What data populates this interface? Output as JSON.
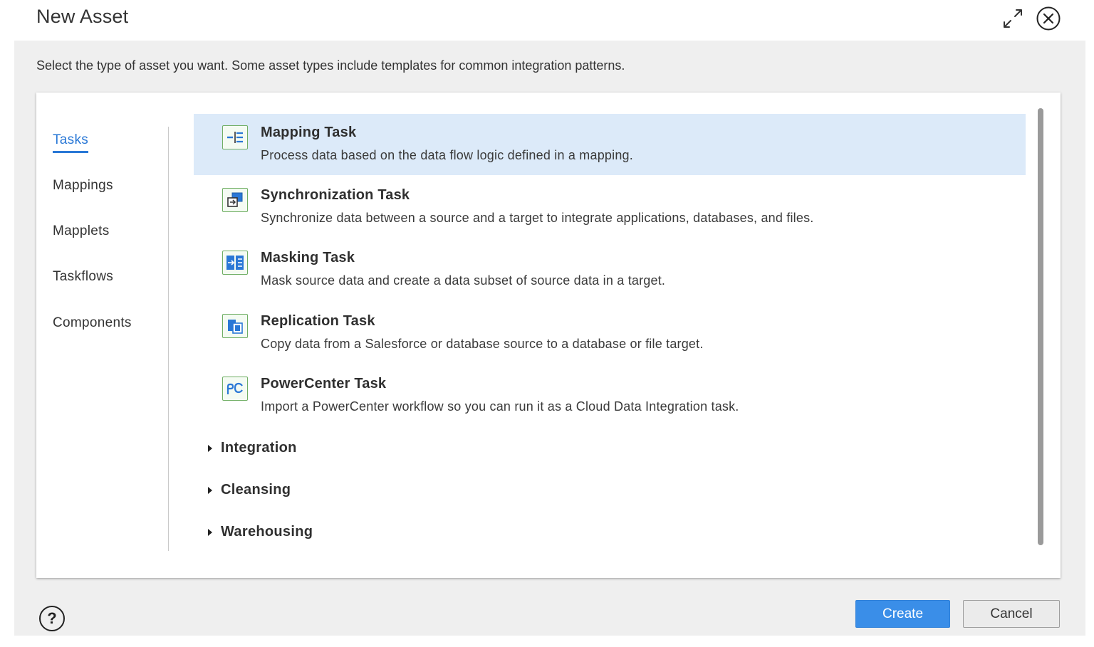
{
  "dialog": {
    "title": "New Asset",
    "instructions": "Select the type of asset you want. Some asset types include templates for common integration patterns."
  },
  "icons": {
    "maximize": "expand-arrows-icon",
    "close": "close-circle-icon",
    "help": "question-circle-icon"
  },
  "categories": [
    {
      "label": "Tasks",
      "active": true
    },
    {
      "label": "Mappings",
      "active": false
    },
    {
      "label": "Mapplets",
      "active": false
    },
    {
      "label": "Taskflows",
      "active": false
    },
    {
      "label": "Components",
      "active": false
    }
  ],
  "assets": [
    {
      "name": "Mapping Task",
      "description": "Process data based on the data flow logic defined in a mapping.",
      "icon": "mapping-task-icon",
      "selected": true
    },
    {
      "name": "Synchronization Task",
      "description": "Synchronize data between a source and a target to integrate applications, databases, and files.",
      "icon": "synchronization-task-icon",
      "selected": false
    },
    {
      "name": "Masking Task",
      "description": "Mask source data and create a data subset of source data in a target.",
      "icon": "masking-task-icon",
      "selected": false
    },
    {
      "name": "Replication Task",
      "description": "Copy data from a Salesforce or database source to a database or file target.",
      "icon": "replication-task-icon",
      "selected": false
    },
    {
      "name": "PowerCenter Task",
      "description": "Import a PowerCenter workflow so you can run it as a Cloud Data Integration task.",
      "icon": "powercenter-task-icon",
      "selected": false
    }
  ],
  "groups": [
    {
      "label": "Integration"
    },
    {
      "label": "Cleansing"
    },
    {
      "label": "Warehousing"
    }
  ],
  "buttons": {
    "create": "Create",
    "cancel": "Cancel",
    "help_glyph": "?"
  },
  "colors": {
    "accent": "#2a78d6",
    "selected_row": "#dceaf9",
    "primary_button": "#3a8ee8",
    "icon_border": "#6fae63"
  }
}
